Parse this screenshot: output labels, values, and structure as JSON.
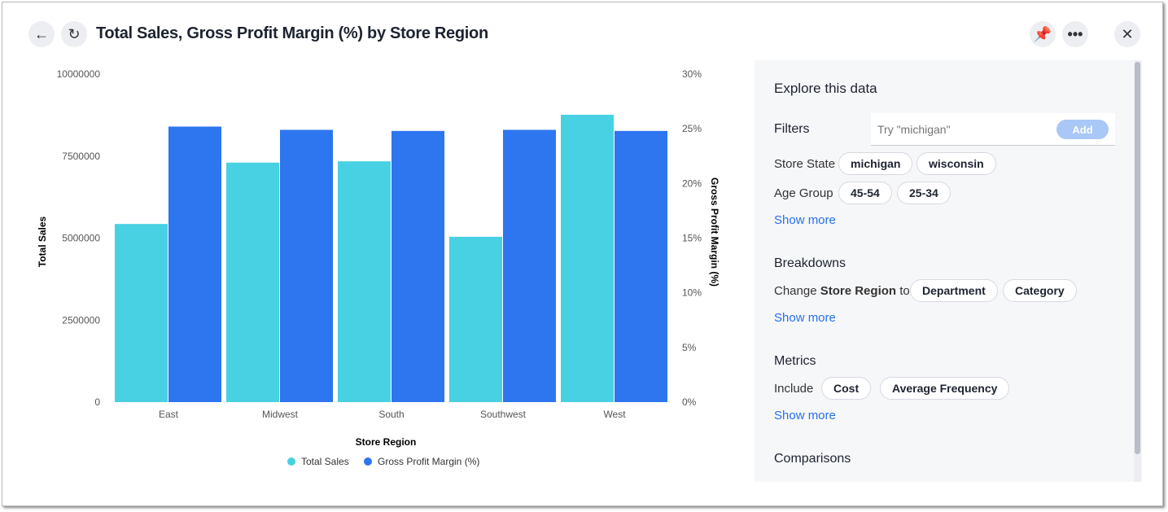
{
  "header": {
    "title": "Total Sales, Gross Profit Margin (%) by Store Region",
    "back_icon": "arrow-left-icon",
    "refresh_icon": "refresh-icon",
    "pin_icon": "pin-icon",
    "more_icon": "more-icon",
    "close_icon": "close-icon"
  },
  "colors": {
    "total_sales": "#47d1e2",
    "gross_profit_margin": "#2e75f0",
    "link": "#2770ef"
  },
  "chart_data": {
    "type": "bar",
    "title": "Total Sales, Gross Profit Margin (%) by Store Region",
    "categories": [
      "East",
      "Midwest",
      "South",
      "Southwest",
      "West"
    ],
    "series": [
      {
        "name": "Total Sales",
        "axis": "left",
        "values": [
          5430000,
          7300000,
          7340000,
          5040000,
          8760000
        ]
      },
      {
        "name": "Gross Profit Margin (%)",
        "axis": "right",
        "values": [
          25.2,
          24.9,
          24.8,
          24.9,
          24.8
        ]
      }
    ],
    "xlabel": "Store Region",
    "ylabel": "Total Sales",
    "y2label": "Gross Profit Margin (%)",
    "ylim": [
      0,
      10000000
    ],
    "y2lim": [
      0,
      30
    ],
    "yticks": [
      "0",
      "2500000",
      "5000000",
      "7500000",
      "10000000"
    ],
    "y2ticks": [
      "0%",
      "5%",
      "10%",
      "15%",
      "20%",
      "25%",
      "30%"
    ],
    "grid": false,
    "legend": "bottom"
  },
  "panel": {
    "title": "Explore this data",
    "filters": {
      "title": "Filters",
      "placeholder": "Try \"michigan\"",
      "add": "Add",
      "rows": [
        {
          "label": "Store State",
          "chips": [
            "michigan",
            "wisconsin"
          ]
        },
        {
          "label": "Age Group",
          "chips": [
            "45-54",
            "25-34"
          ]
        }
      ],
      "show_more": "Show more"
    },
    "breakdowns": {
      "title": "Breakdowns",
      "prefix": "Change",
      "field": "Store Region",
      "suffix": "to",
      "chips": [
        "Department",
        "Category"
      ],
      "show_more": "Show more"
    },
    "metrics": {
      "title": "Metrics",
      "label": "Include",
      "chips": [
        "Cost",
        "Average Frequency"
      ],
      "show_more": "Show more"
    },
    "comparisons": {
      "title": "Comparisons"
    }
  }
}
